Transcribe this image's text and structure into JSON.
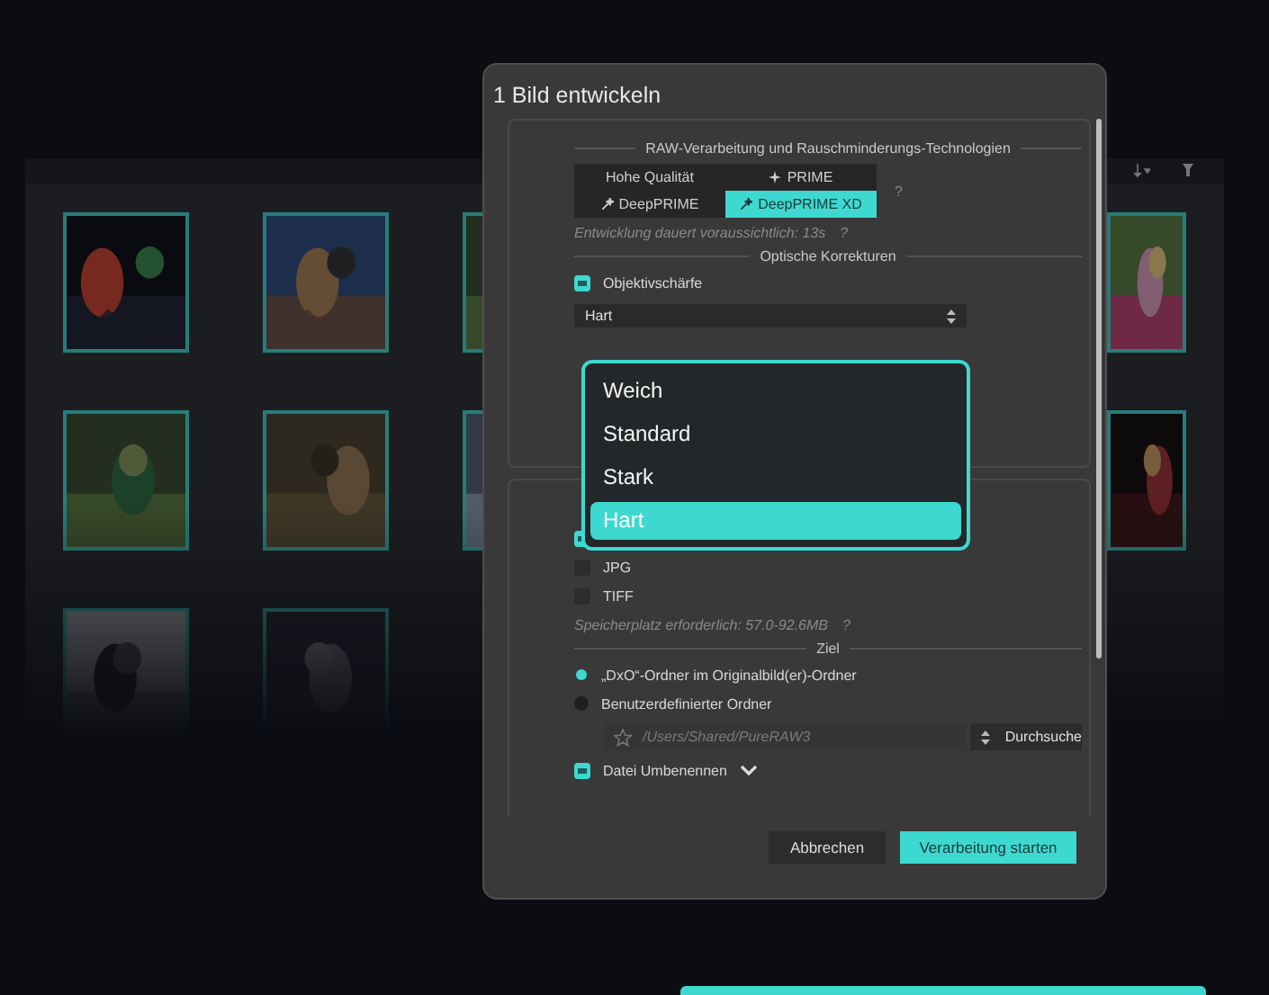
{
  "dialog": {
    "title": "1 Bild entwickeln",
    "raw": {
      "heading": "RAW-Verarbeitung und Rauschminderungs-Technologien",
      "options": [
        {
          "label": "Hohe Qualität",
          "kind": "text",
          "selected": false
        },
        {
          "label": "PRIME",
          "kind": "sparkle",
          "selected": false
        },
        {
          "label": "DeepPRIME",
          "kind": "wand",
          "selected": false
        },
        {
          "label": "DeepPRIME XD",
          "kind": "wand",
          "selected": true
        }
      ],
      "help": "?",
      "estimate": "Entwicklung dauert voraussichtlich: 13s",
      "estimate_help": "?"
    },
    "optics": {
      "heading": "Optische Korrekturen",
      "sharpness": {
        "label": "Objektivschärfe",
        "checked": true
      },
      "strength": "Hart"
    },
    "formats": [
      {
        "checked": true
      },
      {
        "label": "JPG",
        "checked": false
      },
      {
        "label": "TIFF",
        "checked": false
      }
    ],
    "storage": "Speicherplatz erforderlich: 57.0-92.6MB",
    "storage_help": "?",
    "destination": {
      "heading": "Ziel",
      "options": [
        {
          "label": "„DxO“-Ordner im Originalbild(er)-Ordner",
          "selected": true
        },
        {
          "label": "Benutzerdefinierter Ordner",
          "selected": false
        }
      ],
      "path": "/Users/Shared/PureRAW3",
      "browse": "Durchsuche"
    },
    "rename": {
      "label": "Datei Umbenennen",
      "checked": true
    },
    "buttons": [
      {
        "label": "Abbrechen",
        "kind": "secondary"
      },
      {
        "label": "Verarbeitung starten",
        "kind": "primary"
      }
    ]
  },
  "dropdown": {
    "options": [
      {
        "label": "Weich",
        "selected": false
      },
      {
        "label": "Standard",
        "selected": false
      },
      {
        "label": "Stark",
        "selected": false
      },
      {
        "label": "Hart",
        "selected": true
      }
    ]
  }
}
